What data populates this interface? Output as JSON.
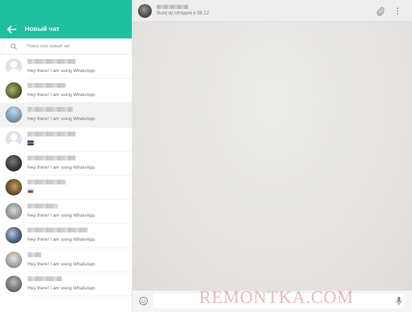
{
  "left_panel": {
    "header": {
      "back_icon": "arrow-left-icon",
      "title": "Новый чат",
      "background_color": "#1fbf9f"
    },
    "search": {
      "icon": "search-icon",
      "placeholder": "Поиск или новый чат"
    },
    "contacts": [
      {
        "status": "Hey there! I am using WhatsApp.",
        "avatar": "default"
      },
      {
        "status": "Hey there! I am using WhatsApp.",
        "avatar": "photo"
      },
      {
        "status": "Hey there! I am using WhatsApp.",
        "avatar": "photo",
        "active": true
      },
      {
        "status": "",
        "status_icon": "uk-flag-emoji",
        "avatar": "default"
      },
      {
        "status": "Hey there! I am using WhatsApp.",
        "avatar": "photo"
      },
      {
        "status": "",
        "status_icon": "russia-flag-emoji",
        "avatar": "photo"
      },
      {
        "status": "Hey there! I am using WhatsApp.",
        "avatar": "photo"
      },
      {
        "status": "Hey there! I am using WhatsApp.",
        "avatar": "photo"
      },
      {
        "status": "Hey there! I am using WhatsApp.",
        "avatar": "photo"
      },
      {
        "status": "Hey there! I am using WhatsApp.",
        "avatar": "photo"
      }
    ]
  },
  "chat_panel": {
    "header": {
      "status": "был(-а) сегодня в 08.12",
      "attach_icon": "paperclip-icon",
      "menu_icon": "more-vertical-icon"
    },
    "composer": {
      "emoji_icon": "smiley-icon",
      "value": "",
      "mic_icon": "microphone-icon"
    }
  },
  "watermark": "REMONTKA.COM"
}
